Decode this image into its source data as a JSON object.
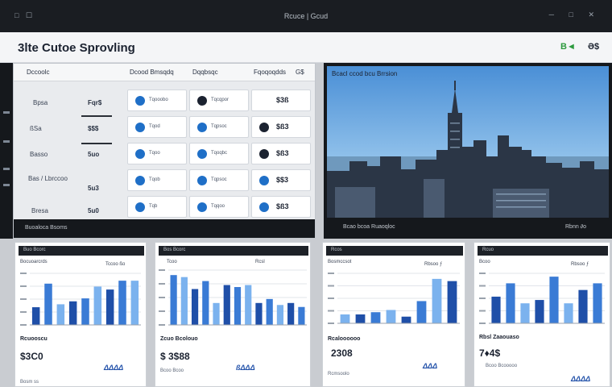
{
  "window": {
    "controls_left": "□ ☐",
    "title": "Rcuce | Gcud",
    "controls_right": "─ □ ✕"
  },
  "header": {
    "title": "3lte Cutoe Sprovling",
    "badge": "B◄",
    "user": "Ə$"
  },
  "table": {
    "headers": [
      "Dccoolc",
      "Dcood Bmsqdq",
      "Dqqbsqc",
      "Fqoqoqdds",
      "G$"
    ],
    "rows": [
      {
        "label": "Bpsa",
        "value": "Fqr$"
      },
      {
        "label": "ßSa",
        "value": "$$$"
      },
      {
        "label": "Basso",
        "value": "5uo"
      },
      {
        "label": "Bas / Lbrccoo",
        "value": "5u3"
      },
      {
        "label": "Bresa",
        "value": "5u0"
      }
    ],
    "tiles": [
      [
        {
          "text": "Tqooobo"
        },
        {
          "text": "Tqcqpor"
        },
        {
          "value": "$3ß"
        }
      ],
      [
        {
          "text": "Tqod"
        },
        {
          "text": "Tqpsoc"
        },
        {
          "value": "$ß3"
        }
      ],
      [
        {
          "text": "Tqoo"
        },
        {
          "text": "Tqoqbc"
        },
        {
          "value": "$ß3"
        }
      ],
      [
        {
          "text": "Tqob"
        },
        {
          "text": "Tqpsoc"
        },
        {
          "value": "$$3"
        }
      ],
      [
        {
          "text": "Tqb"
        },
        {
          "text": "Tqqoo"
        },
        {
          "value": "$ß3"
        }
      ]
    ],
    "footer": "Buoaloca Bsoms"
  },
  "skyline": {
    "title": "Bcacl ccod bcu Brrsion",
    "footer_left": "Bcao bcoa Ruaoqloc",
    "footer_right": "Rbnn ∂o"
  },
  "cards": [
    {
      "header": "Buo Bcorc",
      "subtitle": "Bocuoarcrds",
      "subtitle_right": "Tccoo ßo",
      "value": "$3C0",
      "caption": "Rcuooscu",
      "small": "Bosm ss",
      "blue": "ΔΔΔΔ"
    },
    {
      "header": "Bos Bcorc",
      "subtitle": "Tcoo",
      "subtitle_right": "Rcsl",
      "value": "$ 3$88",
      "caption": "Zcuo Bcolouo",
      "small": "Bcoo Bcoo",
      "blue": "ßΔΔΔ"
    },
    {
      "header": "Rcos",
      "subtitle": "Bosmccsot",
      "subtitle_right": "Rbsoo ƒ",
      "value": "2308",
      "caption": "Rcaloooooo",
      "small": "Rcmsoolo",
      "blue": "ΔΔΔ"
    },
    {
      "header": "Rcuo",
      "subtitle": "Bcoo",
      "subtitle_right": "Rbsoo ƒ",
      "value": "7♦4$",
      "caption": "Rbsl Zaaouaso",
      "small": "Bcoo Bcooooo",
      "blue": "ΔΔΔΔ"
    }
  ],
  "chart_data": [
    {
      "type": "bar",
      "values": [
        12,
        28,
        14,
        16,
        18,
        26,
        24,
        30,
        30
      ],
      "ylim": [
        0,
        35
      ]
    },
    {
      "type": "bar",
      "values": [
        50,
        48,
        36,
        44,
        22,
        40,
        38,
        40,
        22,
        26,
        20,
        22,
        18
      ],
      "ylim": [
        0,
        55
      ]
    },
    {
      "type": "bar",
      "values": [
        8,
        8,
        10,
        12,
        6,
        20,
        40,
        38
      ],
      "ylim": [
        0,
        45
      ]
    },
    {
      "type": "bar",
      "values": [
        8,
        12,
        6,
        7,
        14,
        6,
        10,
        12
      ],
      "ylim": [
        0,
        15
      ]
    }
  ],
  "colors": {
    "bar_dark": "#1f4fa8",
    "bar_mid": "#3a7bd5",
    "bar_light": "#7bb2ee",
    "ic_blue": "#1f6fc7",
    "ic_dark": "#1b2230"
  }
}
